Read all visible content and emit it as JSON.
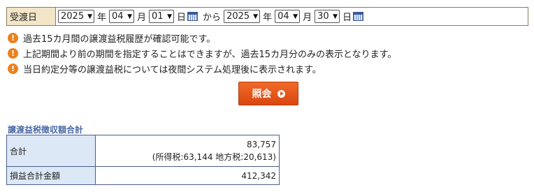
{
  "date_filter": {
    "label": "受渡日",
    "from": {
      "year": "2025",
      "month": "04",
      "day": "01"
    },
    "to": {
      "year": "2025",
      "month": "04",
      "day": "30"
    },
    "units": {
      "year": "年",
      "month": "月",
      "day": "日"
    },
    "separator": "から"
  },
  "notes": [
    "過去15カ月間の譲渡益税履歴が確認可能です。",
    "上記期間より前の期間を指定することはできますが、過去15カ月分のみの表示となります。",
    "当日約定分等の譲渡益税については夜間システム処理後に表示されます。"
  ],
  "inquiry_button": {
    "label": "照会"
  },
  "summary": {
    "title": "譲渡益税徴収額合計",
    "total_label": "合計",
    "total_value": "83,757",
    "total_breakdown": "(所得税:63,144 地方税:20,613)",
    "pl_label": "損益合計金額",
    "pl_value": "412,342"
  },
  "colors": {
    "accent": "#e8811f",
    "button": "#e0561a",
    "section_title": "#4a6aa6"
  },
  "icons": {
    "note": "warning-icon",
    "calendar": "calendar-icon",
    "button": "play-icon"
  }
}
